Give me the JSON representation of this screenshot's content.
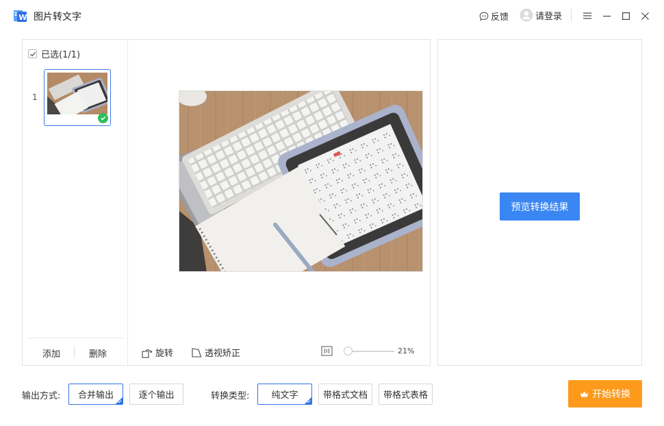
{
  "app": {
    "title": "图片转文字"
  },
  "header": {
    "feedback": "反馈",
    "login": "请登录"
  },
  "thumbs": {
    "select_all": "已选(1/1)",
    "index": "1",
    "add": "添加",
    "delete": "删除"
  },
  "toolbar": {
    "rotate": "旋转",
    "perspective": "透视矫正",
    "zoom": "21%"
  },
  "right_panel": {
    "preview_button": "预览转换结果"
  },
  "bottom": {
    "output_label": "输出方式:",
    "output_options": [
      "合并输出",
      "逐个输出"
    ],
    "output_selected": "合并输出",
    "convert_label": "转换类型:",
    "convert_options": [
      "纯文字",
      "带格式文档",
      "带格式表格"
    ],
    "convert_selected": "纯文字",
    "start_button": "开始转换"
  },
  "colors": {
    "accent": "#3a86f3",
    "start": "#fd9a1c",
    "success": "#2ebd59"
  }
}
